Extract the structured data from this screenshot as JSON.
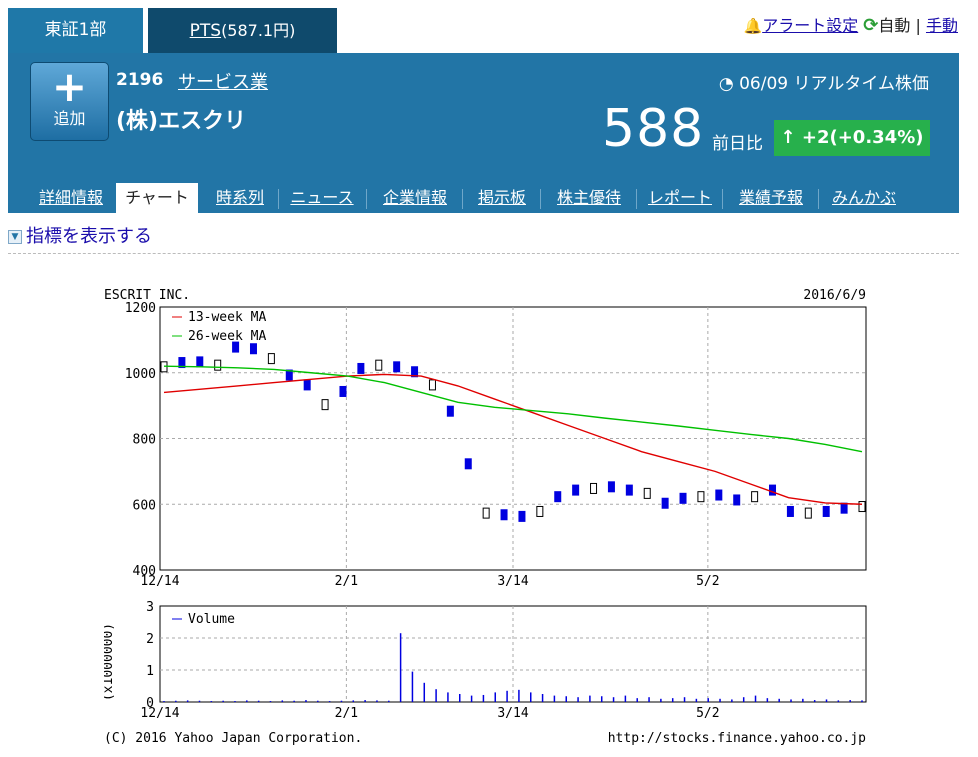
{
  "tabs": {
    "market": "東証1部",
    "pts_label": "PTS",
    "pts_value": "(587.1円)"
  },
  "alert": {
    "alert_setting": "アラート設定",
    "auto": "自動",
    "divider": "|",
    "manual": "手動"
  },
  "stock": {
    "add_plus": "+",
    "add_label": "追加",
    "code": "2196",
    "industry": "サービス業",
    "name": "(株)エスクリ",
    "time": "06/09",
    "rt_label": "リアルタイム株価",
    "price": "588",
    "change_label": "前日比",
    "change": "+2(+0.34%)"
  },
  "subnav": [
    {
      "label": "詳細情報"
    },
    {
      "label": "チャート",
      "active": true
    },
    {
      "label": "時系列"
    },
    {
      "label": "ニュース"
    },
    {
      "label": "企業情報"
    },
    {
      "label": "掲示板"
    },
    {
      "label": "株主優待"
    },
    {
      "label": "レポート"
    },
    {
      "label": "業績予報"
    },
    {
      "label": "みんかぶ"
    }
  ],
  "indicator_link": "指標を表示する",
  "colors": {
    "header": "#2275a6",
    "accent_green": "#27b04c",
    "ma13": "#e00000",
    "ma26": "#00c000",
    "candle": "#0000e0"
  },
  "chart_data": [
    {
      "type": "line",
      "title": "ESCRIT INC.",
      "date": "2016/6/9",
      "ylim": [
        400,
        1200
      ],
      "yticks": [
        400,
        600,
        800,
        1000,
        1200
      ],
      "xticks": [
        "12/14",
        "2/1",
        "3/14",
        "5/2"
      ],
      "grid": true,
      "series": [
        {
          "name": "13-week MA",
          "color": "#e00000",
          "values": [
            940,
            950,
            960,
            970,
            980,
            990,
            995,
            990,
            960,
            920,
            880,
            840,
            800,
            760,
            730,
            700,
            660,
            620,
            604,
            600
          ]
        },
        {
          "name": "26-week MA",
          "color": "#00c000",
          "values": [
            1020,
            1018,
            1015,
            1010,
            1000,
            990,
            970,
            940,
            910,
            895,
            885,
            875,
            862,
            850,
            838,
            825,
            812,
            800,
            782,
            760
          ]
        }
      ],
      "price": [
        1015,
        1028,
        1030,
        1020,
        1075,
        1070,
        1040,
        990,
        960,
        900,
        940,
        1010,
        1020,
        1015,
        1000,
        960,
        880,
        720,
        570,
        565,
        560,
        575,
        620,
        640,
        645,
        650,
        640,
        630,
        600,
        615,
        620,
        625,
        610,
        620,
        640,
        575,
        570,
        575,
        585,
        590
      ]
    },
    {
      "type": "bar",
      "series_name": "Volume",
      "ylabel": "(x1000000)",
      "ylim": [
        0,
        3
      ],
      "yticks": [
        0,
        1,
        2,
        3
      ],
      "xticks": [
        "12/14",
        "2/1",
        "3/14",
        "5/2"
      ],
      "values": [
        0.03,
        0.04,
        0.05,
        0.04,
        0.03,
        0.04,
        0.03,
        0.05,
        0.04,
        0.03,
        0.05,
        0.04,
        0.06,
        0.04,
        0.03,
        0.04,
        0.05,
        0.06,
        0.05,
        0.04,
        2.15,
        0.95,
        0.6,
        0.4,
        0.3,
        0.25,
        0.2,
        0.22,
        0.3,
        0.35,
        0.38,
        0.3,
        0.25,
        0.2,
        0.18,
        0.15,
        0.2,
        0.18,
        0.15,
        0.2,
        0.12,
        0.15,
        0.1,
        0.12,
        0.15,
        0.1,
        0.12,
        0.1,
        0.08,
        0.15,
        0.2,
        0.12,
        0.1,
        0.08,
        0.1,
        0.06,
        0.08,
        0.05,
        0.06,
        0.05
      ]
    }
  ],
  "footer": {
    "copyright": "(C) 2016 Yahoo Japan Corporation.",
    "url": "http://stocks.finance.yahoo.co.jp"
  }
}
